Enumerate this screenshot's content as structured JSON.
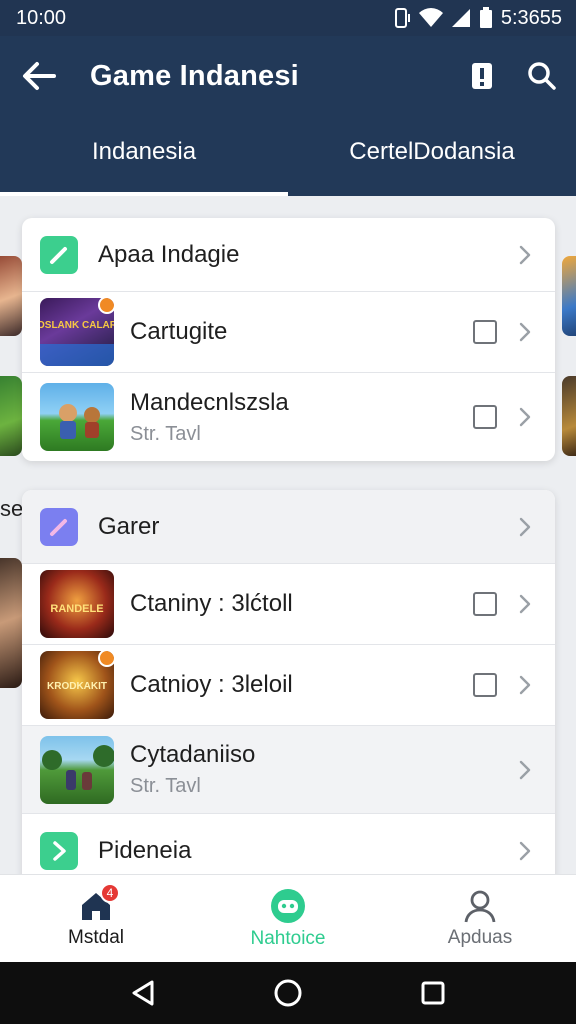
{
  "status": {
    "time": "10:00",
    "right_text": "5:3655"
  },
  "app_bar": {
    "title": "Game Indanesi",
    "back_icon": "arrow-left-icon",
    "info_icon": "alert-icon",
    "search_icon": "search-icon"
  },
  "tabs": [
    {
      "label": "Indanesia",
      "active": true
    },
    {
      "label": "CertelDodansia",
      "active": false
    }
  ],
  "peek_text": "se",
  "card1": {
    "header": {
      "label": "Apaa Indagie",
      "icon": "pencil-icon",
      "icon_color": "#3ccf8e"
    },
    "games": [
      {
        "title": "Cartugite",
        "subtitle": "",
        "art_text": "KOSLANK CALARA",
        "checkbox": true
      },
      {
        "title": "Mandecnlszsla",
        "subtitle": "Str. Tavl",
        "art_text": "",
        "checkbox": true
      }
    ]
  },
  "card2": {
    "header": {
      "label": "Garer",
      "icon": "pencil-icon",
      "icon_color": "#7b7ff0"
    },
    "games": [
      {
        "title": "Ctaniny : 3lćtoll",
        "subtitle": "",
        "art_text": "RANDELE",
        "checkbox": true
      },
      {
        "title": "Catnioy : 3leloil",
        "subtitle": "",
        "art_text": "KRODKAKIT",
        "checkbox": true
      },
      {
        "title": "Cytadaniiso",
        "subtitle": "Str. Tavl",
        "art_text": "",
        "checkbox": false
      }
    ],
    "footer": {
      "label": "Pideneia",
      "icon": "chevron-right-icon",
      "icon_color": "#3ccf8e"
    }
  },
  "bottom_nav": [
    {
      "label": "Mstdal",
      "icon": "home-icon",
      "badge": "4",
      "color": "#1a1a1a"
    },
    {
      "label": "Nahtoice",
      "icon": "gamepad-icon",
      "badge": "",
      "color": "#2ecc8f"
    },
    {
      "label": "Apduas",
      "icon": "person-icon",
      "badge": "",
      "color": "#6b6f75"
    }
  ]
}
